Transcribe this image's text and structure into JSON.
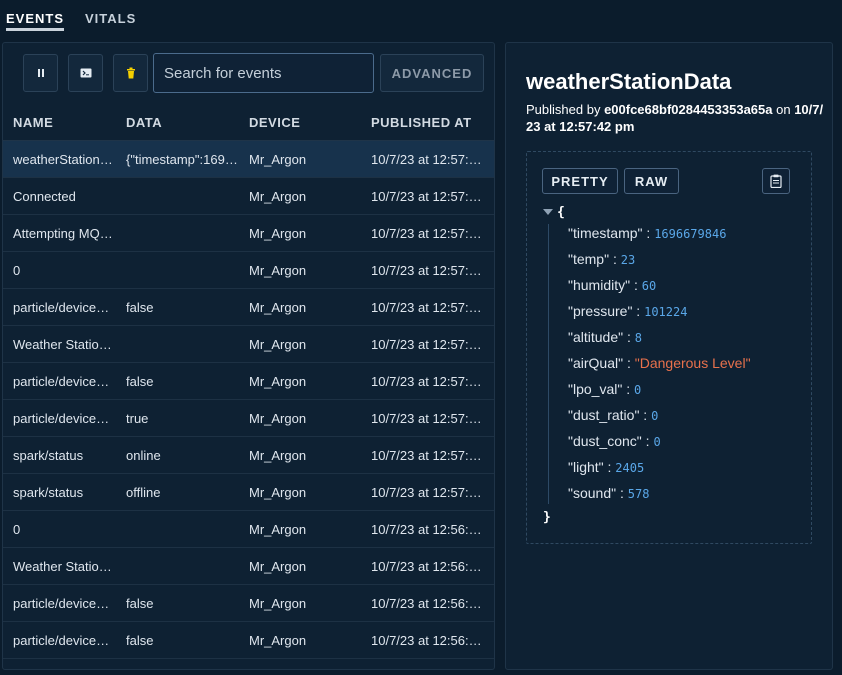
{
  "tabs": {
    "events": "EVENTS",
    "vitals": "VITALS"
  },
  "toolbar": {
    "search_placeholder": "Search for events",
    "advanced_label": "ADVANCED"
  },
  "table": {
    "headers": {
      "name": "NAME",
      "data": "DATA",
      "device": "DEVICE",
      "published": "PUBLISHED AT"
    },
    "rows": [
      {
        "name": "weatherStation…",
        "data": "{\"timestamp\":169…",
        "device": "Mr_Argon",
        "published": "10/7/23 at 12:57:…"
      },
      {
        "name": "Connected",
        "data": "",
        "device": "Mr_Argon",
        "published": "10/7/23 at 12:57:…"
      },
      {
        "name": "Attempting MQ…",
        "data": "",
        "device": "Mr_Argon",
        "published": "10/7/23 at 12:57:2…"
      },
      {
        "name": "0",
        "data": "",
        "device": "Mr_Argon",
        "published": "10/7/23 at 12:57:2…"
      },
      {
        "name": "particle/device…",
        "data": "false",
        "device": "Mr_Argon",
        "published": "10/7/23 at 12:57:…"
      },
      {
        "name": "Weather Statio…",
        "data": "",
        "device": "Mr_Argon",
        "published": "10/7/23 at 12:57:…"
      },
      {
        "name": "particle/device…",
        "data": "false",
        "device": "Mr_Argon",
        "published": "10/7/23 at 12:57:…"
      },
      {
        "name": "particle/device…",
        "data": "true",
        "device": "Mr_Argon",
        "published": "10/7/23 at 12:57:…"
      },
      {
        "name": "spark/status",
        "data": "online",
        "device": "Mr_Argon",
        "published": "10/7/23 at 12:57:…"
      },
      {
        "name": "spark/status",
        "data": "offline",
        "device": "Mr_Argon",
        "published": "10/7/23 at 12:57:…"
      },
      {
        "name": "0",
        "data": "",
        "device": "Mr_Argon",
        "published": "10/7/23 at 12:56:…"
      },
      {
        "name": "Weather Statio…",
        "data": "",
        "device": "Mr_Argon",
        "published": "10/7/23 at 12:56:…"
      },
      {
        "name": "particle/device…",
        "data": "false",
        "device": "Mr_Argon",
        "published": "10/7/23 at 12:56:…"
      },
      {
        "name": "particle/device…",
        "data": "false",
        "device": "Mr_Argon",
        "published": "10/7/23 at 12:56:…"
      }
    ]
  },
  "detail": {
    "title": "weatherStationData",
    "published_prefix": "Published by ",
    "device_id": "e00fce68bf0284453353a65a",
    "published_on": " on ",
    "published_at": "10/7/23 at 12:57:42 pm",
    "pretty_label": "PRETTY",
    "raw_label": "RAW",
    "open_brace": "{",
    "close_brace": "}",
    "fields": [
      {
        "key": "\"timestamp\"",
        "value": "1696679846",
        "type": "number"
      },
      {
        "key": "\"temp\"",
        "value": "23",
        "type": "number"
      },
      {
        "key": "\"humidity\"",
        "value": "60",
        "type": "number"
      },
      {
        "key": "\"pressure\"",
        "value": "101224",
        "type": "number"
      },
      {
        "key": "\"altitude\"",
        "value": "8",
        "type": "number"
      },
      {
        "key": "\"airQual\"",
        "value": "\"Dangerous Level\"",
        "type": "string"
      },
      {
        "key": "\"lpo_val\"",
        "value": "0",
        "type": "number"
      },
      {
        "key": "\"dust_ratio\"",
        "value": "0",
        "type": "number"
      },
      {
        "key": "\"dust_conc\"",
        "value": "0",
        "type": "number"
      },
      {
        "key": "\"light\"",
        "value": "2405",
        "type": "number"
      },
      {
        "key": "\"sound\"",
        "value": "578",
        "type": "number"
      }
    ]
  },
  "colors": {
    "background": "#0b1c2c",
    "panel": "#0e2133",
    "selected_row": "#17324c",
    "json_number": "#5aa7e8",
    "json_string": "#e8714c",
    "trash_icon": "#f5d000"
  },
  "icons": [
    "pause-icon",
    "terminal-icon",
    "trash-icon",
    "clipboard-icon",
    "collapse-arrow-icon"
  ]
}
